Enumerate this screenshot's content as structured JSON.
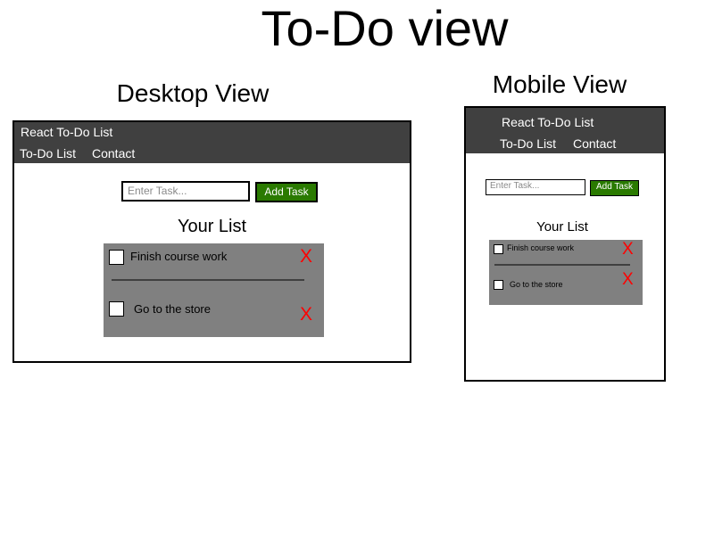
{
  "page_title": "To-Do view",
  "desktop": {
    "heading": "Desktop View",
    "app_title": "React To-Do List",
    "nav": [
      "To-Do List",
      "Contact"
    ],
    "input_placeholder": "Enter Task...",
    "add_button": "Add Task",
    "list_heading": "Your List",
    "tasks": [
      "Finish course work",
      "Go to the store"
    ],
    "delete_label": "X"
  },
  "mobile": {
    "heading": "Mobile View",
    "app_title": "React To-Do List",
    "nav": [
      "To-Do List",
      "Contact"
    ],
    "input_placeholder": "Enter Task...",
    "add_button": "Add Task",
    "list_heading": "Your List",
    "tasks": [
      "Finish course work",
      "Go to the store"
    ],
    "delete_label": "X"
  },
  "colors": {
    "navbar": "#404040",
    "button": "#2a7a00",
    "list_panel": "#808080",
    "delete": "#ff0000"
  }
}
